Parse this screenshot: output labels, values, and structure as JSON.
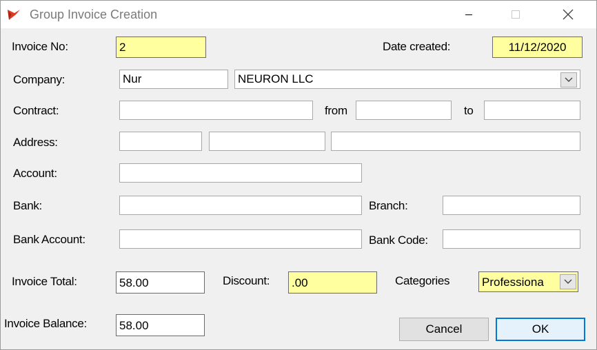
{
  "window": {
    "title": "Group Invoice Creation"
  },
  "form": {
    "invoice_no_label": "Invoice No:",
    "invoice_no_value": "2",
    "date_created_label": "Date created:",
    "date_created_value": "11/12/2020",
    "company_label": "Company:",
    "company_code": "Nur",
    "company_name": "NEURON LLC",
    "contract_label": "Contract:",
    "contract_value": "",
    "from_label": "from",
    "from_value": "",
    "to_label": "to",
    "to_value": "",
    "address_label": "Address:",
    "address_1": "",
    "address_2": "",
    "address_3": "",
    "account_label": "Account:",
    "account_value": "",
    "bank_label": "Bank:",
    "bank_value": "",
    "branch_label": "Branch:",
    "branch_value": "",
    "bank_account_label": "Bank Account:",
    "bank_account_value": "",
    "bank_code_label": "Bank Code:",
    "bank_code_value": "",
    "invoice_total_label": "Invoice Total:",
    "invoice_total_value": "58.00",
    "discount_label": "Discount:",
    "discount_value": ".00",
    "categories_label": "Categories",
    "categories_value": "Professiona",
    "invoice_balance_label": "Invoice Balance:",
    "invoice_balance_value": "58.00"
  },
  "buttons": {
    "cancel": "Cancel",
    "ok": "OK"
  },
  "colors": {
    "highlight_field": "#ffffa0",
    "ok_border": "#0078d7",
    "app_icon": "#e03a1e"
  },
  "icons": {
    "app": "app-logo-icon",
    "minimize": "minimize-icon",
    "maximize": "maximize-icon",
    "close": "close-icon",
    "dropdown": "chevron-down-icon"
  }
}
